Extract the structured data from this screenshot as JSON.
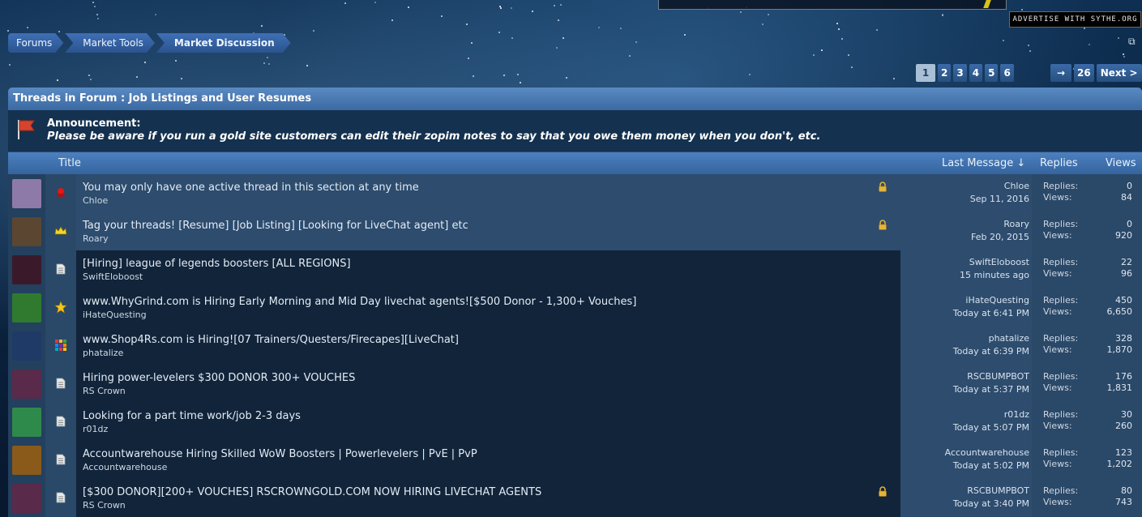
{
  "ad": {
    "advertise_text": "ADVERTISE WITH SYTHE.ORG"
  },
  "breadcrumb": [
    {
      "label": "Forums"
    },
    {
      "label": "Market Tools"
    },
    {
      "label": "Market Discussion"
    }
  ],
  "pagination": {
    "current": "1",
    "pages": [
      "2",
      "3",
      "4",
      "5",
      "6"
    ],
    "arrow": "→",
    "last": "26",
    "next": "Next >"
  },
  "forum": {
    "header": "Threads in Forum : Job Listings and User Resumes",
    "announcement_label": "Announcement:",
    "announcement_text": "Please be aware if you run a gold site customers can edit their zopim notes to say that you owe them money when you don't, etc."
  },
  "columns": {
    "title": "Title",
    "last_message": "Last Message ↓",
    "replies": "Replies",
    "views": "Views"
  },
  "stat_labels": {
    "replies": "Replies:",
    "views": "Views:"
  },
  "threads": [
    {
      "title": "You may only have one active thread in this section at any time",
      "author": "Chloe",
      "last_user": "Chloe",
      "last_date": "Sep 11, 2016",
      "replies": "0",
      "views": "84",
      "sticky": true,
      "locked": true,
      "status_icon": "red-ribbon-icon",
      "avatar_color": "#8e7aa8"
    },
    {
      "title": "Tag your threads! [Resume] [Job Listing] [Looking for LiveChat agent] etc",
      "author": "Roary",
      "last_user": "Roary",
      "last_date": "Feb 20, 2015",
      "replies": "0",
      "views": "920",
      "sticky": true,
      "locked": true,
      "status_icon": "crown-icon",
      "avatar_color": "#5b4631"
    },
    {
      "title": "[Hiring] league of legends boosters [ALL REGIONS]",
      "author": "SwiftEloboost",
      "last_user": "SwiftEloboost",
      "last_date": "15 minutes ago",
      "replies": "22",
      "views": "96",
      "sticky": false,
      "locked": false,
      "status_icon": "document-icon",
      "avatar_color": "#3a1a2a"
    },
    {
      "title": "www.WhyGrind.com is Hiring Early Morning and Mid Day livechat agents![$500 Donor - 1,300+ Vouches]",
      "author": "iHateQuesting",
      "last_user": "iHateQuesting",
      "last_date": "Today at 6:41 PM",
      "replies": "450",
      "views": "6,650",
      "sticky": false,
      "locked": false,
      "status_icon": "star-icon",
      "avatar_color": "#2f7a2f"
    },
    {
      "title": "www.Shop4Rs.com is Hiring![07 Trainers/Questers/Firecapes][LiveChat]",
      "author": "phatalize",
      "last_user": "phatalize",
      "last_date": "Today at 6:39 PM",
      "replies": "328",
      "views": "1,870",
      "sticky": false,
      "locked": false,
      "status_icon": "grid-icon",
      "avatar_color": "#1f3a66"
    },
    {
      "title": "Hiring power-levelers $300 DONOR 300+ VOUCHES",
      "author": "RS Crown",
      "last_user": "RSCBUMPBOT",
      "last_date": "Today at 5:37 PM",
      "replies": "176",
      "views": "1,831",
      "sticky": false,
      "locked": false,
      "status_icon": "document-icon",
      "avatar_color": "#5a2a4a"
    },
    {
      "title": "Looking for a part time work/job 2-3 days",
      "author": "r01dz",
      "last_user": "r01dz",
      "last_date": "Today at 5:07 PM",
      "replies": "30",
      "views": "260",
      "sticky": false,
      "locked": false,
      "status_icon": "document-icon",
      "avatar_color": "#2e8a4a"
    },
    {
      "title": "Accountwarehouse Hiring Skilled WoW Boosters | Powerlevelers | PvE | PvP",
      "author": "Accountwarehouse",
      "last_user": "Accountwarehouse",
      "last_date": "Today at 5:02 PM",
      "replies": "123",
      "views": "1,202",
      "sticky": false,
      "locked": false,
      "status_icon": "document-icon",
      "avatar_color": "#8a5a1a"
    },
    {
      "title": "[$300 DONOR][200+ VOUCHES] RSCROWNGOLD.COM NOW HIRING LIVECHAT AGENTS",
      "author": "RS Crown",
      "last_user": "RSCBUMPBOT",
      "last_date": "Today at 3:40 PM",
      "replies": "80",
      "views": "743",
      "sticky": false,
      "locked": true,
      "status_icon": "document-icon",
      "avatar_color": "#5a2a4a"
    }
  ]
}
